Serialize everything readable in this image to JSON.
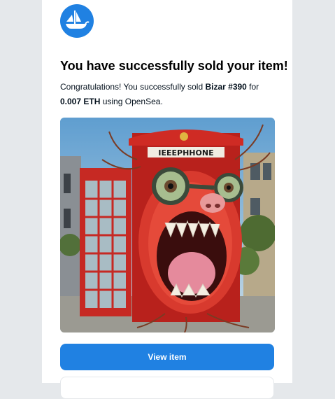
{
  "brand": {
    "logo_icon": "opensea-boat-icon",
    "accent": "#2081e2"
  },
  "email": {
    "title": "You have successfully sold your item!",
    "message_prefix": "Congratulations! You successfully sold ",
    "item_name": "Bizar #390",
    "message_mid": " for ",
    "price": "0.007 ETH",
    "message_suffix": " using OpenSea.",
    "artwork_sign": "IEEEPHHONE"
  },
  "actions": {
    "view_item_label": "View item"
  }
}
